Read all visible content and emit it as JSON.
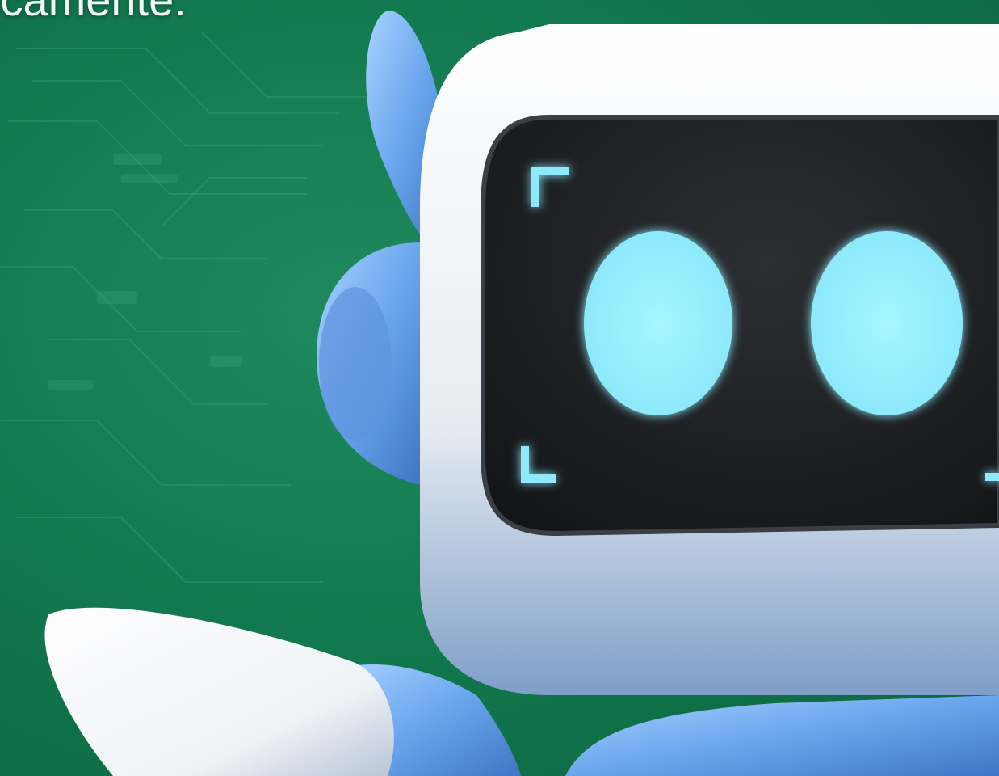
{
  "headline": {
    "text": "icamente."
  },
  "colors": {
    "background": "#137a4f",
    "robot_shell": "#f4f6fa",
    "robot_accent": "#6aaaf0",
    "screen": "#1b1d20",
    "eyes": "#9ef2ff"
  },
  "illustration": {
    "subject": "robot-mascot",
    "icons": [
      "circuit-board-pattern",
      "robot-head",
      "robot-ear",
      "robot-antenna",
      "robot-eye",
      "screen-corner-bracket",
      "robot-arm"
    ]
  }
}
